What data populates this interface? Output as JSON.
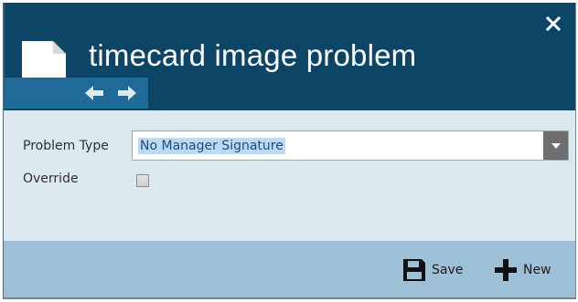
{
  "dialog": {
    "title": "timecard image problem",
    "close_icon": "close-icon",
    "document_icon": "document-icon",
    "nav": {
      "back_icon": "arrow-left-icon",
      "forward_icon": "arrow-right-icon"
    }
  },
  "form": {
    "problem_type": {
      "label": "Problem Type",
      "value": "No Manager Signature",
      "dropdown_icon": "chevron-down-icon"
    },
    "override": {
      "label": "Override",
      "checked": false
    }
  },
  "footer": {
    "save": {
      "label": "Save",
      "icon": "floppy-disk-icon"
    },
    "new": {
      "label": "New",
      "icon": "plus-icon"
    }
  },
  "colors": {
    "header": "#0c4566",
    "nav_box": "#1f6a97",
    "body": "#dce9f1",
    "footer": "#9ec0d6",
    "selection_highlight": "#bcdaf5"
  }
}
